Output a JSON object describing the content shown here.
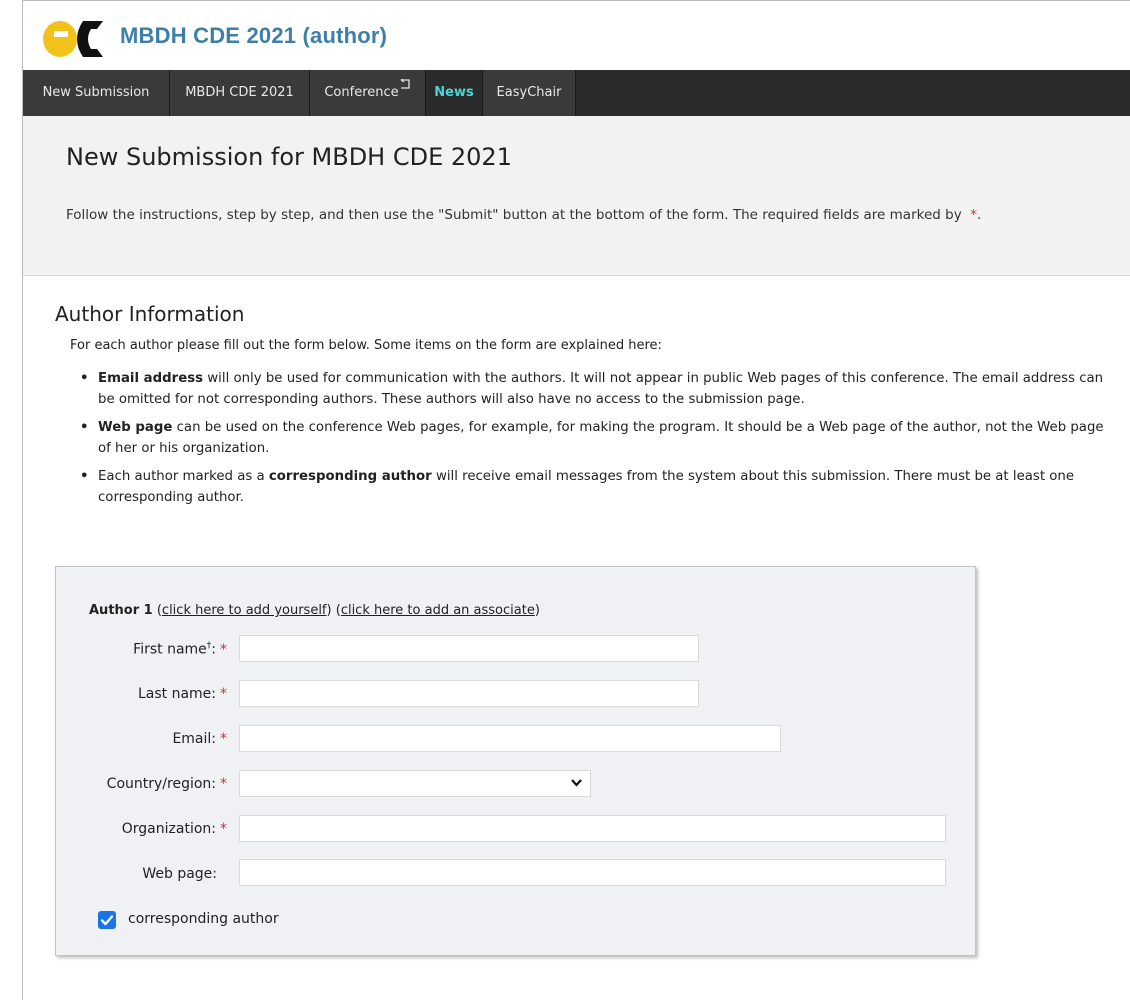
{
  "app": {
    "title": "MBDH CDE 2021 (author)",
    "brand_colors": {
      "logo_left": "#f2c21b",
      "logo_right": "#111111",
      "title": "#3e7fa8"
    }
  },
  "nav": {
    "items": [
      {
        "label": "New Submission"
      },
      {
        "label": "MBDH CDE 2021"
      },
      {
        "label": "Conference"
      },
      {
        "label": "News"
      },
      {
        "label": "EasyChair"
      }
    ]
  },
  "intro": {
    "heading": "New Submission for MBDH CDE 2021",
    "instructions": "Follow the instructions, step by step, and then use the \"Submit\" button at the bottom of the form. The required fields are marked by",
    "required_marker": "*",
    "instructions_end": "."
  },
  "author_info": {
    "title": "Author Information",
    "intro": "For each author please fill out the form below. Some items on the form are explained here:",
    "bullets": [
      {
        "bold": "Email address",
        "text": " will only be used for communication with the authors. It will not appear in public Web pages of this conference. The email address can be omitted for not corresponding authors. These authors will also have no access to the submission page."
      },
      {
        "bold": "Web page",
        "text": " can be used on the conference Web pages, for example, for making the program. It should be a Web page of the author, not the Web page of her or his organization."
      },
      {
        "prefix": "Each author marked as a ",
        "bold": "corresponding author",
        "text": " will receive email messages from the system about this submission. There must be at least one corresponding author."
      }
    ]
  },
  "author_form": {
    "heading": "Author 1",
    "open_paren": "(",
    "close_paren": ")",
    "add_yourself": "click here to add yourself",
    "add_associate": "click here to add an associate",
    "fields": [
      {
        "label": "First name",
        "sup": "†",
        "suffix": ":",
        "required": true,
        "value": ""
      },
      {
        "label": "Last name:",
        "required": true,
        "value": ""
      },
      {
        "label": "Email:",
        "required": true,
        "value": ""
      },
      {
        "label": "Country/region:",
        "required": true,
        "value": ""
      },
      {
        "label": "Organization:",
        "required": true,
        "value": ""
      },
      {
        "label": "Web page:",
        "required": false,
        "value": ""
      }
    ],
    "corresponding": {
      "label": "corresponding author",
      "checked": true
    }
  }
}
